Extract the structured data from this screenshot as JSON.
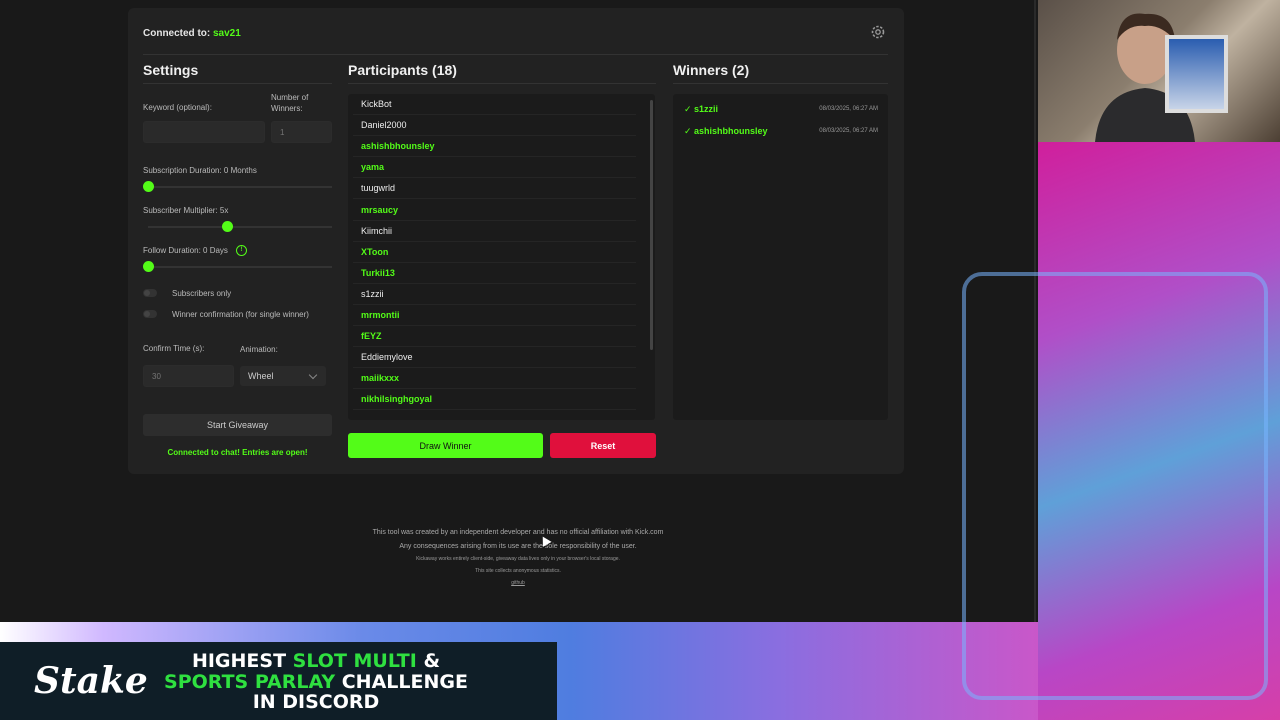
{
  "header": {
    "connected_label": "Connected to:",
    "channel": "sav21"
  },
  "settings": {
    "title": "Settings",
    "keyword_label": "Keyword (optional):",
    "keyword_value": "",
    "winners_label_line1": "Number of",
    "winners_label_line2": "Winners:",
    "winners_placeholder": "1",
    "sub_duration_label": "Subscription Duration: 0 Months",
    "sub_duration_value": 0,
    "sub_multiplier_label": "Subscriber Multiplier: 5x",
    "sub_multiplier_value": 0.43,
    "follow_duration_label": "Follow Duration:  0  Days",
    "follow_duration_value": 0,
    "info_glyph": "!",
    "subs_only_label": "Subscribers only",
    "winner_confirm_label": "Winner confirmation (for single winner)",
    "confirm_time_label": "Confirm Time (s):",
    "confirm_time_placeholder": "30",
    "animation_label": "Animation:",
    "animation_value": "Wheel",
    "start_button": "Start Giveaway",
    "status_text": "Connected to chat! Entries are open!"
  },
  "participants": {
    "title": "Participants (18)",
    "items": [
      {
        "name": "KickBot",
        "sub": false
      },
      {
        "name": "Daniel2000",
        "sub": false
      },
      {
        "name": "ashishbhounsley",
        "sub": true
      },
      {
        "name": "yama",
        "sub": true
      },
      {
        "name": "tuugwrld",
        "sub": false
      },
      {
        "name": "mrsaucy",
        "sub": true
      },
      {
        "name": "Kiimchii",
        "sub": false
      },
      {
        "name": "XToon",
        "sub": true
      },
      {
        "name": "Turkii13",
        "sub": true
      },
      {
        "name": "s1zzii",
        "sub": false
      },
      {
        "name": "mrmontii",
        "sub": true
      },
      {
        "name": "fEYZ",
        "sub": true
      },
      {
        "name": "Eddiemylove",
        "sub": false
      },
      {
        "name": "maiikxxx",
        "sub": true
      },
      {
        "name": "nikhilsinghgoyal",
        "sub": true
      }
    ],
    "draw_button": "Draw Winner",
    "reset_button": "Reset"
  },
  "winners": {
    "title": "Winners (2)",
    "items": [
      {
        "name": "✓ s1zzii",
        "date": "08/03/2025, 06:27 AM"
      },
      {
        "name": "✓ ashishbhounsley",
        "date": "08/03/2025, 06:27 AM"
      }
    ]
  },
  "footer": {
    "line1": "This tool was created by an independent developer and has no official affiliation with Kick.com",
    "line2": "Any consequences arising from its use are the sole responsibility of the user.",
    "line3": "Kickaway works entirely client-side, giveaway data lives only in your browser's local storage.",
    "line4": "This site collects anonymous statistics.",
    "link": "github"
  },
  "banner": {
    "logo": "Stake",
    "line1a": "HIGHEST ",
    "line1b": "SLOT MULTI",
    "line1c": " &",
    "line2a": "SPORTS PARLAY",
    "line2b": " CHALLENGE",
    "line3": "IN DISCORD"
  },
  "colors": {
    "accent": "#53fc18",
    "danger": "#e0103c",
    "card": "#222222",
    "background": "#191919"
  }
}
